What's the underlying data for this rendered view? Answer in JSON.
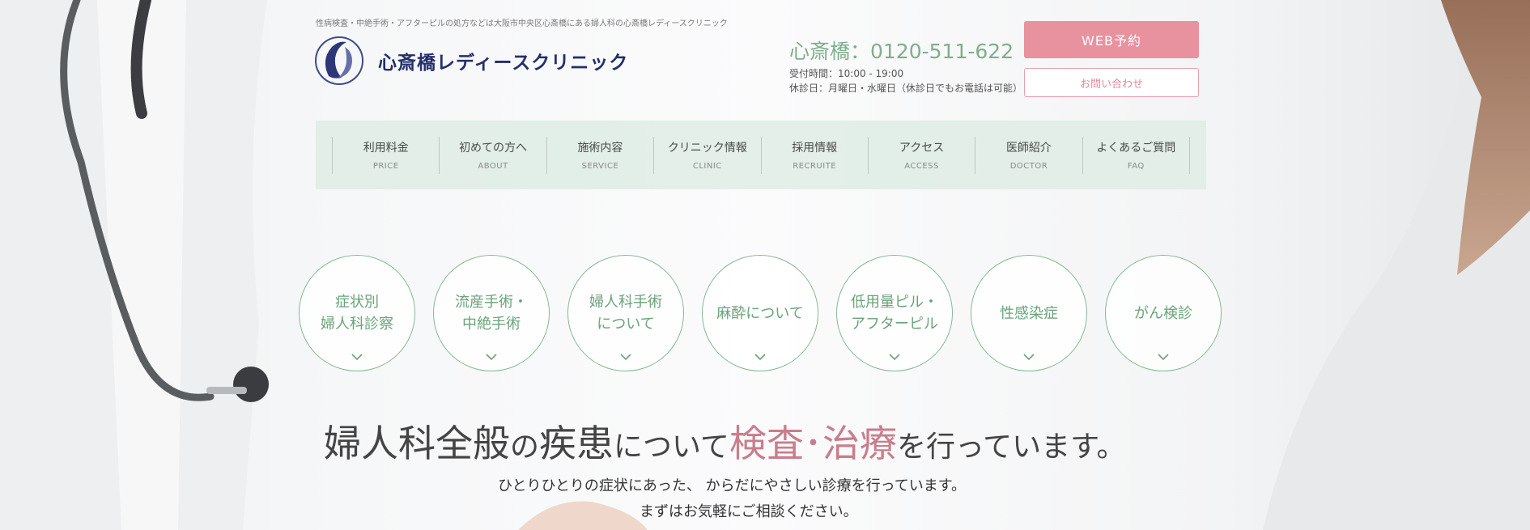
{
  "header": {
    "tagline": "性病検査・中絶手術・アフターピルの処方などは大阪市中央区心斎橋にある婦人科の心斎橋レディースクリニック",
    "clinic_name": "心斎橋レディースクリニック",
    "phone": "心斎橋：0120-511-622",
    "hours": "受付時間：10:00 - 19:00",
    "holidays": "休診日：月曜日・水曜日（休診日でもお電話は可能）",
    "web_reservation_label": "WEB予約",
    "contact_label": "お問い合わせ"
  },
  "nav": {
    "items": [
      {
        "jp": "利用料金",
        "en": "PRICE"
      },
      {
        "jp": "初めての方へ",
        "en": "ABOUT"
      },
      {
        "jp": "施術内容",
        "en": "SERVICE"
      },
      {
        "jp": "クリニック情報",
        "en": "CLINIC"
      },
      {
        "jp": "採用情報",
        "en": "RECRUITE"
      },
      {
        "jp": "アクセス",
        "en": "ACCESS"
      },
      {
        "jp": "医師紹介",
        "en": "DOCTOR"
      },
      {
        "jp": "よくあるご質問",
        "en": "FAQ"
      }
    ]
  },
  "services": {
    "items": [
      {
        "label": "症状別\n婦人科診察"
      },
      {
        "label": "流産手術・\n中絶手術"
      },
      {
        "label": "婦人科手術\nについて"
      },
      {
        "label": "麻酔について"
      },
      {
        "label": "低用量ピル・\nアフターピル"
      },
      {
        "label": "性感染症"
      },
      {
        "label": "がん検診"
      }
    ]
  },
  "hero": {
    "headline_part1": "婦人科全般",
    "headline_part2": "の",
    "headline_part3": "疾患",
    "headline_part4": "について",
    "headline_accent": "検査･治療",
    "headline_part5": "を行っています。",
    "subline1": "ひとりひとりの症状にあった、 からだにやさしい診療を行っています。",
    "subline2": "まずはお気軽にご相談ください。"
  },
  "colors": {
    "accent_pink": "#e8919f",
    "accent_green": "#7fae8c",
    "navy": "#232f6b",
    "nav_bg": "#deece4"
  },
  "icons": {
    "logo": "clinic-logo-icon",
    "circle_chevron": "chevron-down-icon"
  }
}
